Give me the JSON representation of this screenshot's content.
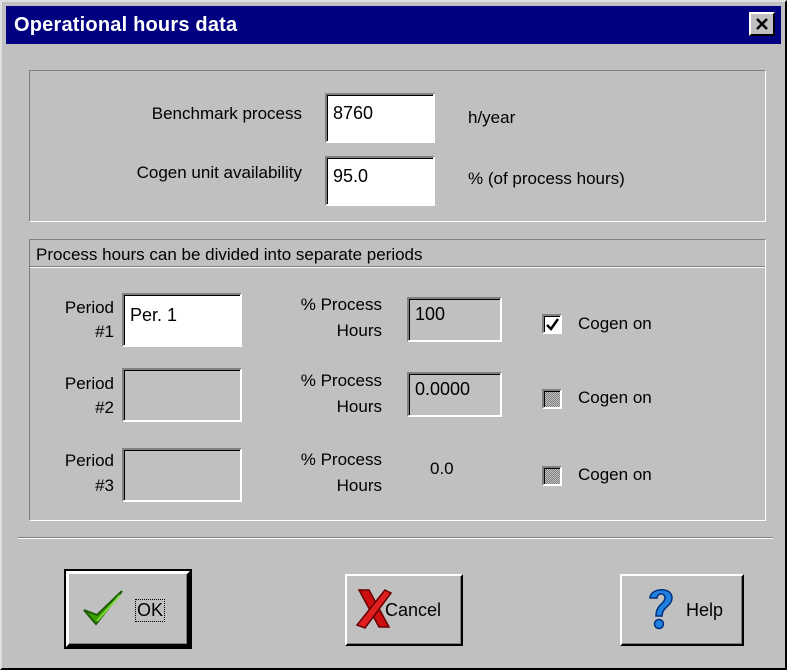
{
  "window": {
    "title": "Operational hours data"
  },
  "top_section": {
    "benchmark": {
      "label": "Benchmark process",
      "value": "8760",
      "unit": "h/year"
    },
    "availability": {
      "label": "Cogen unit availability",
      "value": "95.0",
      "unit": "% (of process hours)"
    }
  },
  "periods_section": {
    "heading": "Process hours can be divided into separate periods",
    "periods": [
      {
        "label_line1": "Period",
        "label_line2": "#1",
        "name": "Per. 1",
        "pct_label_line1": "% Process",
        "pct_label_line2": "Hours",
        "pct_value": "100",
        "cogen_label": "Cogen on",
        "cogen_checked": true
      },
      {
        "label_line1": "Period",
        "label_line2": "#2",
        "name": "",
        "pct_label_line1": "% Process",
        "pct_label_line2": "Hours",
        "pct_value": "0.0000",
        "cogen_label": "Cogen on",
        "cogen_checked": false
      },
      {
        "label_line1": "Period",
        "label_line2": "#3",
        "name": "",
        "pct_label_line1": "% Process",
        "pct_label_line2": "Hours",
        "pct_value": "0.0",
        "cogen_label": "Cogen on",
        "cogen_checked": false
      }
    ]
  },
  "buttons": {
    "ok": "OK",
    "cancel": "Cancel",
    "help": "Help"
  },
  "icons": {
    "close": "close-icon",
    "ok": "green-checkmark-icon",
    "cancel": "red-x-icon",
    "help": "blue-question-mark-icon"
  },
  "colors": {
    "titlebar": "#000080",
    "dialog": "#c0c0c0"
  }
}
